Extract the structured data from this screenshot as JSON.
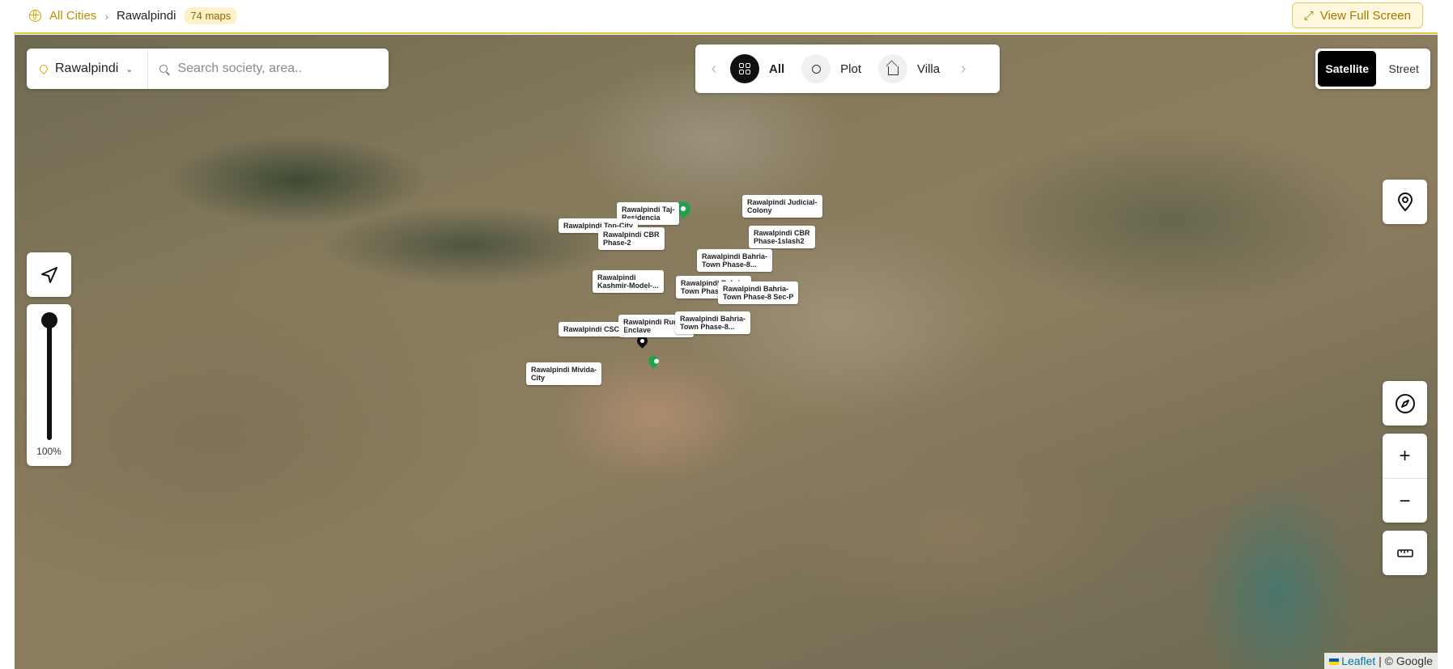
{
  "breadcrumb": {
    "all_cities": "All Cities",
    "current": "Rawalpindi",
    "count_badge": "74 maps"
  },
  "header": {
    "fullscreen_label": "View Full Screen"
  },
  "search": {
    "city": "Rawalpindi",
    "placeholder": "Search society, area.."
  },
  "filters": {
    "all": "All",
    "plot": "Plot",
    "villa": "Villa"
  },
  "layers": {
    "satellite": "Satellite",
    "street": "Street"
  },
  "zoom_slider": {
    "value": "100%"
  },
  "attribution": {
    "leaflet": "Leaflet",
    "rest": "| © Google"
  },
  "map_labels": [
    "Rawalpindi Taj-\nResidencia",
    "Rawalpindi Judicial-\nColony",
    "Rawalpindi Top-City",
    "Rawalpindi CBR\nPhase-2",
    "Rawalpindi CBR\nPhase-1slash2",
    "Rawalpindi Bahria-\nTown Phase-8...",
    "Rawalpindi\nKashmir-Model-...",
    "Rawalpindi Bahria-\nTown Phas...",
    "Rawalpindi Bahria-\nTown Phase-8 Sec-P",
    "Rawalpindi Rudan-\nEnclave",
    "Rawalpindi Bahria-\nTown Phase-8...",
    "Rawalpindi CSC",
    "Rawalpindi Mivida-\nCity"
  ],
  "colors": {
    "accent": "#d8a500",
    "marker_green": "#22a04b"
  }
}
